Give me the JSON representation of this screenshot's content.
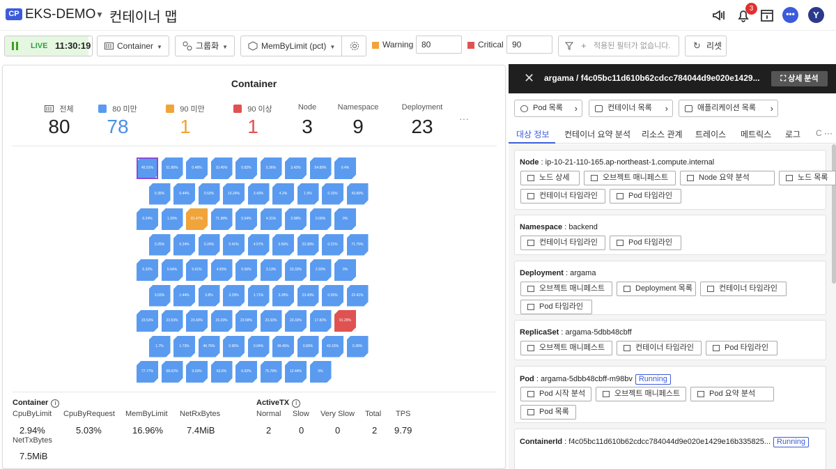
{
  "header": {
    "badge": "CP",
    "project": "EKS-DEMO",
    "page_title": "컨테이너 맵",
    "notification_count": "3",
    "avatar_letter": "Y",
    "icons": [
      "megaphone-icon",
      "bell-icon",
      "calendar-icon",
      "chat-icon"
    ]
  },
  "toolbar": {
    "live_label": "LIVE",
    "time": "11:30:19",
    "object_select": "Container",
    "group_select": "그룹화",
    "metric_select": "MemByLimit (pct)",
    "warning_label": "Warning",
    "warning_value": "80",
    "critical_label": "Critical",
    "critical_value": "90",
    "filter_placeholder": "적용된 필터가 없습니다.",
    "reset_label": "리셋",
    "colors": {
      "warning": "#f0a43a",
      "critical": "#e05252",
      "normal": "#5a9bf0"
    }
  },
  "container_panel": {
    "title": "Container",
    "stats": [
      {
        "label": "전체",
        "value": "80"
      },
      {
        "label": "80 미만",
        "value": "78"
      },
      {
        "label": "90 미만",
        "value": "1"
      },
      {
        "label": "90 이상",
        "value": "1"
      },
      {
        "label": "Node",
        "value": "3"
      },
      {
        "label": "Namespace",
        "value": "9"
      },
      {
        "label": "Deployment",
        "value": "23"
      }
    ],
    "more": "···",
    "cells": [
      [
        "45.91%",
        "51.86%",
        "0.48%",
        "10.45%",
        "0.82%",
        "5.36%",
        "3.42%",
        "54.89%",
        "0.4%"
      ],
      [
        "0.35%",
        "0.44%",
        "0.53%",
        "10.24%",
        "3.43%",
        "4.2%",
        "1.5%",
        "0.16%",
        "43.89%"
      ],
      [
        "0.24%",
        "1.29%",
        "81.47%",
        "71.98%",
        "5.54%",
        "4.31%",
        "2.08%",
        "0.09%",
        "0%"
      ],
      [
        "0.25%",
        "0.24%",
        "0.24%",
        "0.41%",
        "4.57%",
        "3.56%",
        "23.38%",
        "0.21%",
        "71.76%"
      ],
      [
        "5.32%",
        "5.64%",
        "5.61%",
        "4.83%",
        "5.56%",
        "3.13%",
        "23.33%",
        "2.93%",
        "0%"
      ],
      [
        "3.03%",
        "1.44%",
        "3.8%",
        "3.29%",
        "1.71%",
        "3.28%",
        "23.43%",
        "0.55%",
        "22.41%"
      ],
      [
        "23.53%",
        "23.53%",
        "23.43%",
        "23.29%",
        "23.58%",
        "23.33%",
        "23.33%",
        "17.82%",
        "91.29%"
      ],
      [
        "1.7%",
        "1.73%",
        "46.76%",
        "0.95%",
        "0.04%",
        "49.46%",
        "0.83%",
        "43.15%",
        "0.39%"
      ],
      [
        "77.77%",
        "68.62%",
        "9.03%",
        "63.6%",
        "6.92%",
        "75.78%",
        "12.44%",
        "0%"
      ]
    ],
    "container_metrics": {
      "title": "Container",
      "items": [
        {
          "label": "CpuByLimit",
          "value": "2.94%"
        },
        {
          "label": "CpuByRequest",
          "value": "5.03%"
        },
        {
          "label": "MemByLimit",
          "value": "16.96%"
        },
        {
          "label": "NetRxBytes",
          "value": "7.4MiB"
        },
        {
          "label": "NetTxBytes",
          "value": "7.5MiB"
        }
      ]
    },
    "activetx": {
      "title": "ActiveTX",
      "items": [
        {
          "label": "Normal",
          "value": "2"
        },
        {
          "label": "Slow",
          "value": "0"
        },
        {
          "label": "Very Slow",
          "value": "0"
        },
        {
          "label": "Total",
          "value": "2"
        },
        {
          "label": "TPS",
          "value": "9.79"
        }
      ]
    }
  },
  "detail_panel": {
    "title": "argama / f4c05bc11d610b62cdcc784044d9e020e1429...",
    "detail_button": "상세 분석",
    "nav_buttons": [
      "Pod 목록",
      "컨테이너 목록",
      "애플리케이션 목록"
    ],
    "tabs": [
      "대상 정보",
      "컨테이너 요약 분석",
      "리소스 관계",
      "트레이스",
      "메트릭스",
      "로그",
      "C"
    ],
    "node": {
      "label": "Node",
      "value": "ip-10-21-110-165.ap-northeast-1.compute.internal",
      "buttons": [
        "노드 상세",
        "오브젝트 매니페스트",
        "Node 요약 분석",
        "노드 목록",
        "컨테이너 타임라인",
        "Pod 타임라인"
      ]
    },
    "namespace": {
      "label": "Namespace",
      "value": "backend",
      "buttons": [
        "컨테이너 타임라인",
        "Pod 타임라인"
      ]
    },
    "deployment": {
      "label": "Deployment",
      "value": "argama",
      "buttons": [
        "오브젝트 매니페스트",
        "Deployment 목록",
        "컨테이너 타임라인",
        "Pod 타임라인"
      ]
    },
    "replicaset": {
      "label": "ReplicaSet",
      "value": "argama-5dbb48cbff",
      "buttons": [
        "오브젝트 매니페스트",
        "컨테이너 타임라인",
        "Pod 타임라인"
      ]
    },
    "pod": {
      "label": "Pod",
      "value": "argama-5dbb48cbff-m98bv",
      "status": "Running",
      "buttons": [
        "Pod 시작 분석",
        "오브젝트 매니페스트",
        "Pod 요약 분석",
        "Pod 목록"
      ]
    },
    "containerid": {
      "label": "ContainerId",
      "value": "f4c05bc11d610b62cdcc784044d9e020e1429e16b335825...",
      "status": "Running"
    }
  }
}
